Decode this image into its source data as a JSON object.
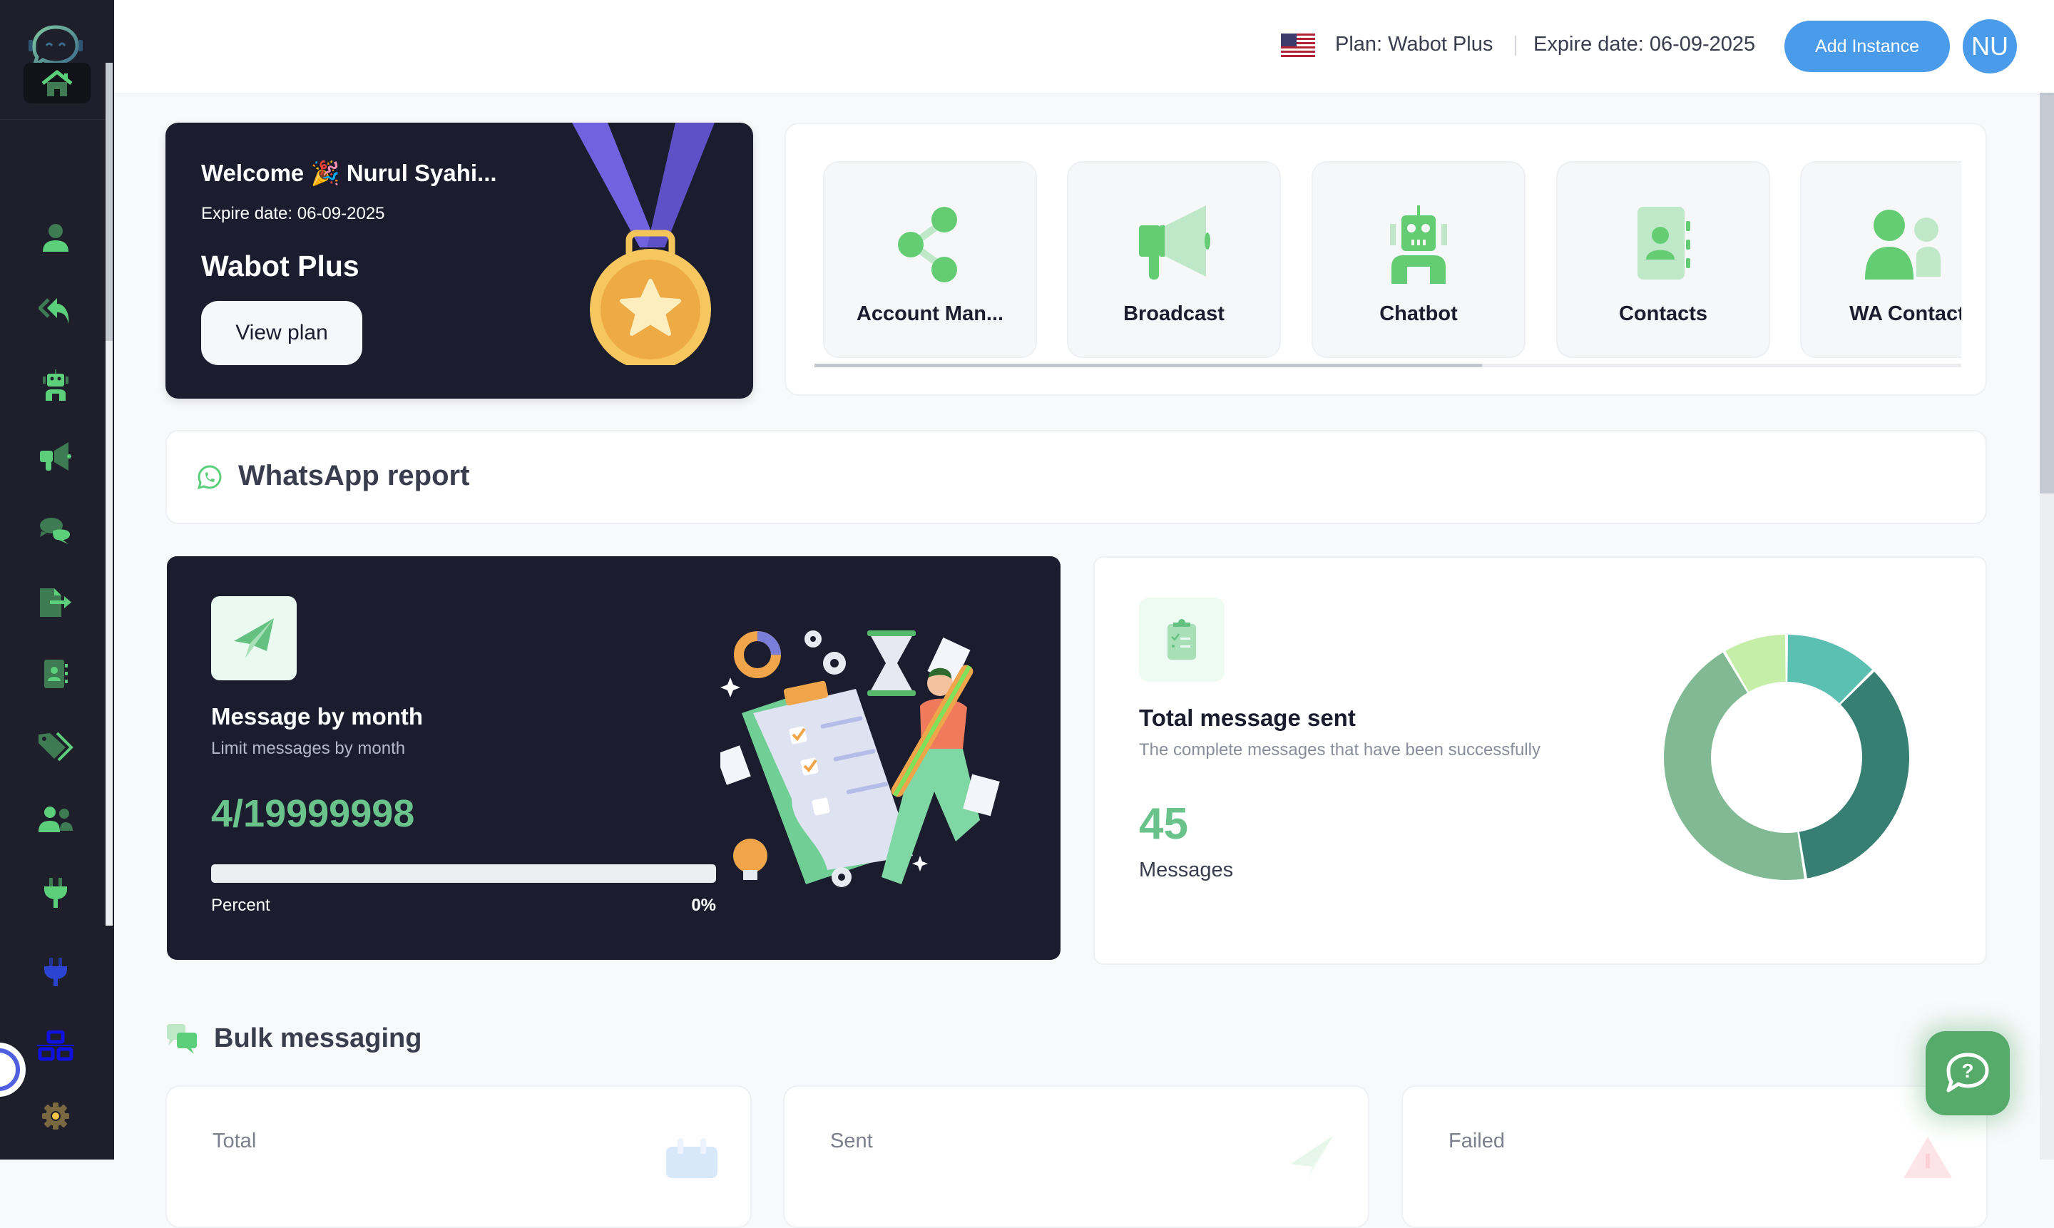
{
  "sidebar": {
    "logo": "wabot-logo",
    "items": [
      {
        "name": "home",
        "icon": "home-icon",
        "active": true
      },
      {
        "name": "account",
        "icon": "user-icon"
      },
      {
        "name": "auto-reply",
        "icon": "reply-all-icon"
      },
      {
        "name": "chatbot",
        "icon": "robot-icon"
      },
      {
        "name": "broadcast",
        "icon": "megaphone-icon"
      },
      {
        "name": "chat",
        "icon": "comments-icon"
      },
      {
        "name": "export",
        "icon": "file-export-icon"
      },
      {
        "name": "contacts",
        "icon": "address-book-icon"
      },
      {
        "name": "tags",
        "icon": "tags-icon"
      },
      {
        "name": "wa-contacts",
        "icon": "users-icon"
      },
      {
        "name": "integration",
        "icon": "plug-icon"
      },
      {
        "name": "api",
        "icon": "plug-blue-icon"
      },
      {
        "name": "network",
        "icon": "sitemap-icon"
      },
      {
        "name": "settings",
        "icon": "gear-icon"
      }
    ]
  },
  "topbar": {
    "language": "English (US)",
    "plan_label": "Plan: Wabot Plus",
    "expire_label": "Expire date: 06-09-2025",
    "add_instance": "Add Instance",
    "avatar_initials": "NU"
  },
  "welcome": {
    "greeting": "Welcome 🎉 Nurul Syahi...",
    "expire": "Expire date: 06-09-2025",
    "plan": "Wabot Plus",
    "view_plan": "View plan"
  },
  "quick_actions": [
    {
      "label": "Account Man...",
      "icon": "share-nodes-icon"
    },
    {
      "label": "Broadcast",
      "icon": "megaphone-icon"
    },
    {
      "label": "Chatbot",
      "icon": "robot-icon"
    },
    {
      "label": "Contacts",
      "icon": "address-book-icon"
    },
    {
      "label": "WA Contact",
      "icon": "users-icon"
    }
  ],
  "report": {
    "title": "WhatsApp report"
  },
  "message_by_month": {
    "title": "Message by month",
    "subtitle": "Limit messages by month",
    "value": "4/19999998",
    "percent_label": "Percent",
    "percent_value": "0%",
    "progress": 0
  },
  "total_message": {
    "title": "Total message sent",
    "subtitle": "The complete messages that have been successfully",
    "value": "45",
    "unit": "Messages"
  },
  "chart_data": {
    "type": "pie",
    "variant": "donut",
    "title": "",
    "series": [
      {
        "name": "segment-1",
        "value": 12.5,
        "color": "#5bc0b2"
      },
      {
        "name": "segment-2",
        "value": 35,
        "color": "#387f73"
      },
      {
        "name": "segment-3",
        "value": 44,
        "color": "#80b993"
      },
      {
        "name": "segment-4",
        "value": 8.5,
        "color": "#c5efa8"
      }
    ],
    "legend": "none"
  },
  "bulk": {
    "title": "Bulk messaging",
    "cards": [
      {
        "label": "Total",
        "icon": "calendar-icon"
      },
      {
        "label": "Sent",
        "icon": "paper-plane-icon"
      },
      {
        "label": "Failed",
        "icon": "warning-icon"
      }
    ]
  },
  "help": {
    "icon": "help-chat-icon"
  },
  "colors": {
    "sidebar_bg": "#1e1f2b",
    "accent_green": "#6ac38b",
    "primary_blue": "#4a9ceb",
    "dark_card": "#1b1c2e"
  }
}
